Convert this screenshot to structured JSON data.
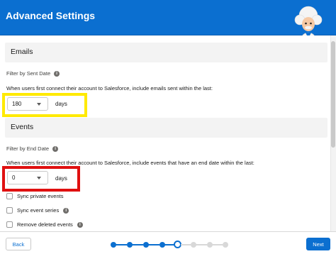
{
  "header": {
    "title": "Advanced Settings"
  },
  "emails": {
    "section_title": "Emails",
    "filter_label": "Filter by Sent Date",
    "description": "When users first connect their account to Salesforce, include emails sent within the last:",
    "select_value": "180",
    "unit": "days"
  },
  "events": {
    "section_title": "Events",
    "filter_label": "Filter by End Date",
    "description": "When users first connect their account to Salesforce, include events that have an end date within the last:",
    "select_value": "0",
    "unit": "days",
    "checkboxes": [
      {
        "label": "Sync private events",
        "checked": false
      },
      {
        "label": "Sync event series",
        "checked": false
      },
      {
        "label": "Remove deleted events",
        "checked": false
      }
    ]
  },
  "footer": {
    "back_label": "Back",
    "next_label": "Next",
    "progress": {
      "total_steps": 8,
      "current_step": 5
    }
  },
  "colors": {
    "brand": "#0b6fd0",
    "highlight_yellow": "#ffea00",
    "highlight_red": "#e01010"
  },
  "icons": [
    "info-icon",
    "chevron-down-icon",
    "astro-mascot"
  ]
}
